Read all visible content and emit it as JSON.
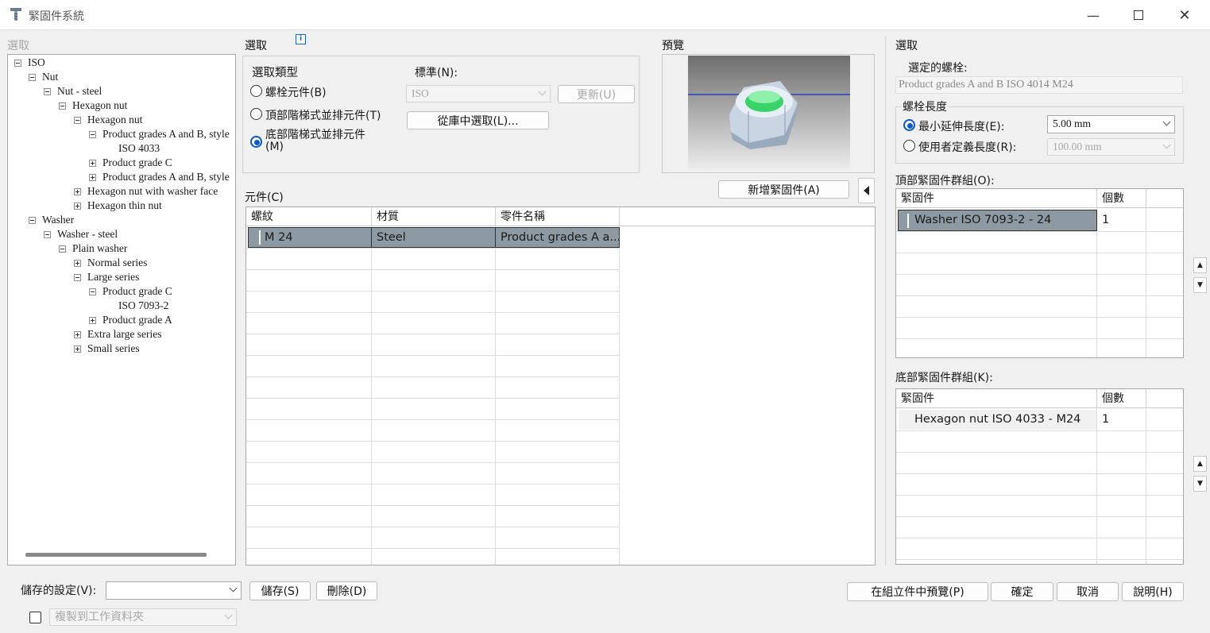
{
  "window": {
    "title": "緊固件系統"
  },
  "tree_panel": {
    "label": "選取",
    "items": [
      {
        "label": "ISO",
        "state": "minus"
      },
      {
        "label": "Nut",
        "state": "minus"
      },
      {
        "label": "Nut - steel",
        "state": "minus"
      },
      {
        "label": "Hexagon nut",
        "state": "minus"
      },
      {
        "label": "Hexagon nut",
        "state": "minus"
      },
      {
        "label": "Product grades A and B, style",
        "state": "minus"
      },
      {
        "label": "ISO 4033",
        "state": "leaf"
      },
      {
        "label": "Product grade C",
        "state": "plus"
      },
      {
        "label": "Product grades A and B, style",
        "state": "plus"
      },
      {
        "label": "Hexagon nut with washer face",
        "state": "plus"
      },
      {
        "label": "Hexagon thin nut",
        "state": "plus"
      },
      {
        "label": "Washer",
        "state": "minus"
      },
      {
        "label": "Washer - steel",
        "state": "minus"
      },
      {
        "label": "Plain washer",
        "state": "minus"
      },
      {
        "label": "Normal series",
        "state": "plus"
      },
      {
        "label": "Large series",
        "state": "minus"
      },
      {
        "label": "Product grade C",
        "state": "minus"
      },
      {
        "label": "ISO 7093-2",
        "state": "leaf"
      },
      {
        "label": "Product grade A",
        "state": "plus"
      },
      {
        "label": "Extra large series",
        "state": "plus"
      },
      {
        "label": "Small series",
        "state": "plus"
      }
    ]
  },
  "selection": {
    "label": "選取",
    "type_label": "選取類型",
    "radio_bolt": "螺栓元件(B)",
    "radio_top": "頂部階梯式並排元件(T)",
    "radio_bottom_line1": "底部階梯式並排元件",
    "radio_bottom_line2": "(M)",
    "standard_label": "標準(N):",
    "standard_value": "ISO",
    "update_button": "更新(U)",
    "library_button": "從庫中選取(L)..."
  },
  "preview": {
    "label": "預覽"
  },
  "components": {
    "label": "元件(C)",
    "add_button": "新增緊固件(A)",
    "columns": [
      "螺紋",
      "材質",
      "零件名稱"
    ],
    "rows": [
      {
        "thread": "M 24",
        "material": "Steel",
        "part": "Product grades A a..."
      }
    ]
  },
  "right": {
    "label": "選取",
    "selected_bolt_label": "選定的螺栓:",
    "selected_bolt_value": "Product grades A and B ISO 4014 M24",
    "bolt_length_label": "螺栓長度",
    "min_ext_label": "最小延伸長度(E):",
    "min_ext_value": "5.00 mm",
    "user_len_label": "使用者定義長度(R):",
    "user_len_value": "100.00 mm",
    "top_group_label": "頂部緊固件群組(O):",
    "top_columns": [
      "緊固件",
      "個數"
    ],
    "top_rows": [
      {
        "name": "Washer ISO 7093-2 - 24",
        "count": "1"
      }
    ],
    "bottom_group_label": "底部緊固件群組(K):",
    "bottom_columns": [
      "緊固件",
      "個數"
    ],
    "bottom_rows": [
      {
        "name": "Hexagon nut ISO 4033 - M24",
        "count": "1"
      }
    ]
  },
  "bottom": {
    "saved_settings_label": "儲存的設定(V):",
    "saved_settings_value": "",
    "save_button": "儲存(S)",
    "delete_button": "刪除(D)",
    "copy_label": "複製到工作資料夾",
    "preview_assembly_button": "在組立件中預覽(P)",
    "ok_button": "確定",
    "cancel_button": "取消",
    "help_button": "說明(H)"
  }
}
